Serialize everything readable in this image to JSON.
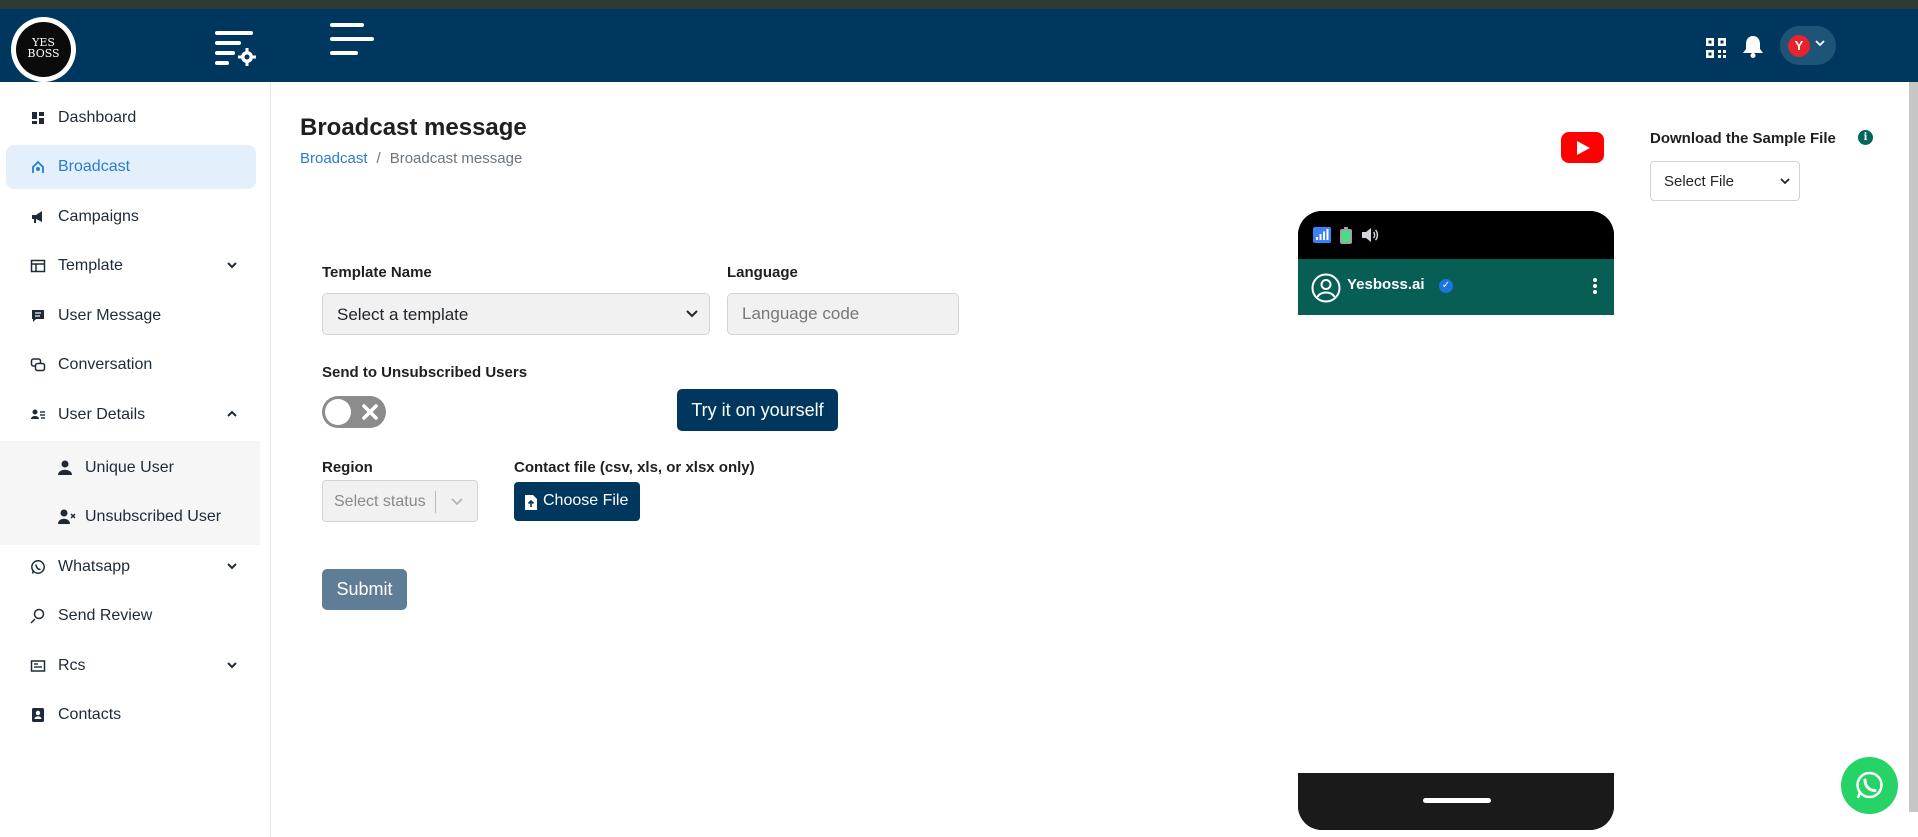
{
  "header": {
    "logo_text_line1": "YES",
    "logo_text_line2": "BOSS",
    "avatar_initial": "Y"
  },
  "sidebar": {
    "items": [
      {
        "label": "Dashboard",
        "icon": "dashboard-icon"
      },
      {
        "label": "Broadcast",
        "icon": "broadcast-icon",
        "active": true
      },
      {
        "label": "Campaigns",
        "icon": "megaphone-icon"
      },
      {
        "label": "Template",
        "icon": "template-icon",
        "chevron": "down"
      },
      {
        "label": "User Message",
        "icon": "message-icon"
      },
      {
        "label": "Conversation",
        "icon": "conversation-icon"
      },
      {
        "label": "User Details",
        "icon": "user-details-icon",
        "chevron": "up"
      },
      {
        "label": "Whatsapp",
        "icon": "whatsapp-icon",
        "chevron": "down"
      },
      {
        "label": "Send Review",
        "icon": "review-icon"
      },
      {
        "label": "Rcs",
        "icon": "rcs-icon",
        "chevron": "down"
      },
      {
        "label": "Contacts",
        "icon": "contacts-icon"
      }
    ],
    "sub_items": [
      {
        "label": "Unique User",
        "icon": "user-icon"
      },
      {
        "label": "Unsubscribed User",
        "icon": "user-remove-icon"
      }
    ]
  },
  "page": {
    "title": "Broadcast message",
    "breadcrumb": {
      "link": "Broadcast",
      "separator": "/",
      "current": "Broadcast message"
    }
  },
  "download": {
    "label": "Download the Sample File",
    "info_glyph": "i",
    "select_value": "Select File"
  },
  "form": {
    "template_label": "Template Name",
    "template_value": "Select a template",
    "language_label": "Language",
    "language_placeholder": "Language code",
    "unsubscribed_label": "Send to Unsubscribed Users",
    "unsubscribed_enabled": false,
    "try_button": "Try it on yourself",
    "region_label": "Region",
    "region_placeholder": "Select status",
    "contact_label": "Contact file (csv, xls, or xlsx only)",
    "choose_file": "Choose File",
    "submit": "Submit"
  },
  "phone": {
    "contact_name": "Yesboss.ai",
    "verified_glyph": "✓"
  },
  "colors": {
    "header": "#00375e",
    "active_bg": "#e3f0fb",
    "active_text": "#2a7bd2",
    "primary_button": "#00375e",
    "submit_button": "#5f7d96",
    "whatsapp_header": "#075e54",
    "whatsapp_green": "#25d366",
    "youtube_red": "#ff0000"
  }
}
